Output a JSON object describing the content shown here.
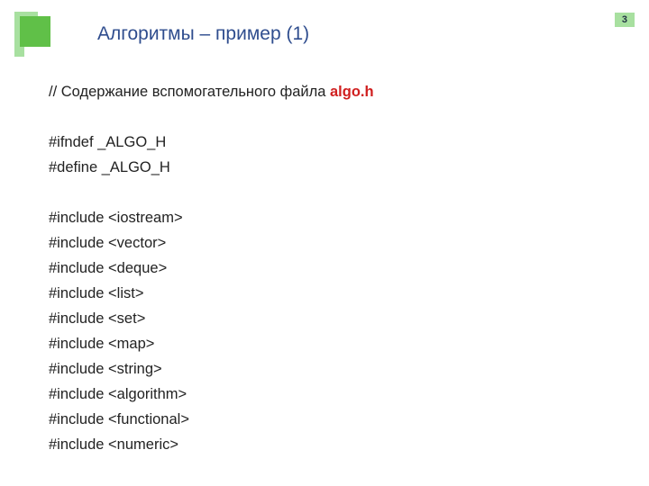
{
  "pageNumber": "3",
  "title": "Алгоритмы – пример  (1)",
  "commentPrefix": "// Содержание вспомогательного файла ",
  "commentFilename": "algo.h",
  "lines1": [
    "#ifndef _ALGO_H",
    "#define _ALGO_H"
  ],
  "lines2": [
    "#include <iostream>",
    "#include <vector>",
    "#include <deque>",
    "#include <list>",
    "#include <set>",
    "#include <map>",
    "#include <string>",
    "#include <algorithm>",
    "#include <functional>",
    "#include <numeric>"
  ]
}
